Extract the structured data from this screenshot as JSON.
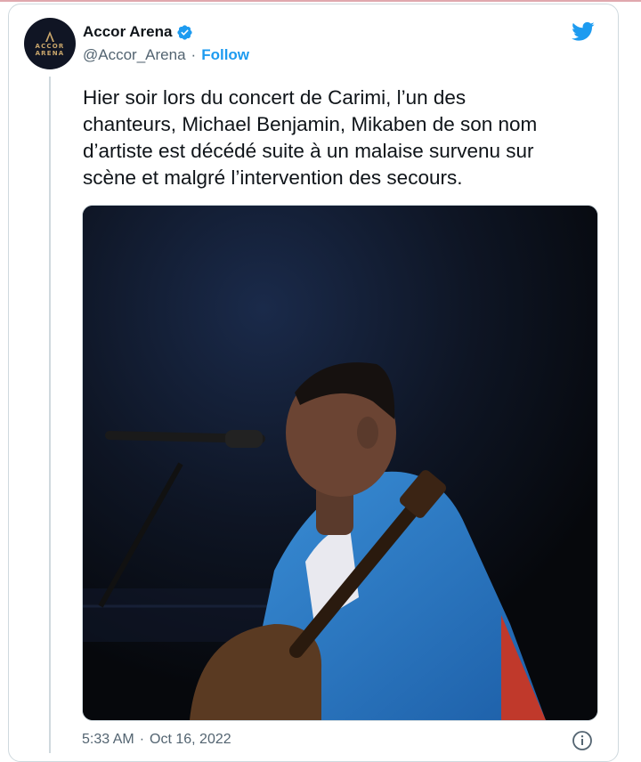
{
  "account": {
    "name": "Accor Arena",
    "handle": "@Accor_Arena",
    "follow_label": "Follow",
    "verified": true,
    "avatar_lines": [
      "ACCOR",
      "ARENA"
    ]
  },
  "separator": "·",
  "tweet": {
    "text_lines": [
      "Hier soir lors du concert de Carimi, l’un des",
      "chanteurs, Michael Benjamin, Mikaben de son nom",
      "d’artiste est décédé suite à un malaise survenu sur",
      "scène et malgré l’intervention des secours."
    ],
    "time": "5:33 AM",
    "date": "Oct 16, 2022"
  },
  "icons": {
    "brand": "twitter-bird-icon",
    "verified": "verified-badge-icon",
    "info": "info-icon"
  },
  "colors": {
    "accent": "#1d9bf0",
    "text": "#0f1419",
    "muted": "#536471",
    "avatar_bg": "#101524",
    "avatar_gold": "#c9a66b"
  }
}
